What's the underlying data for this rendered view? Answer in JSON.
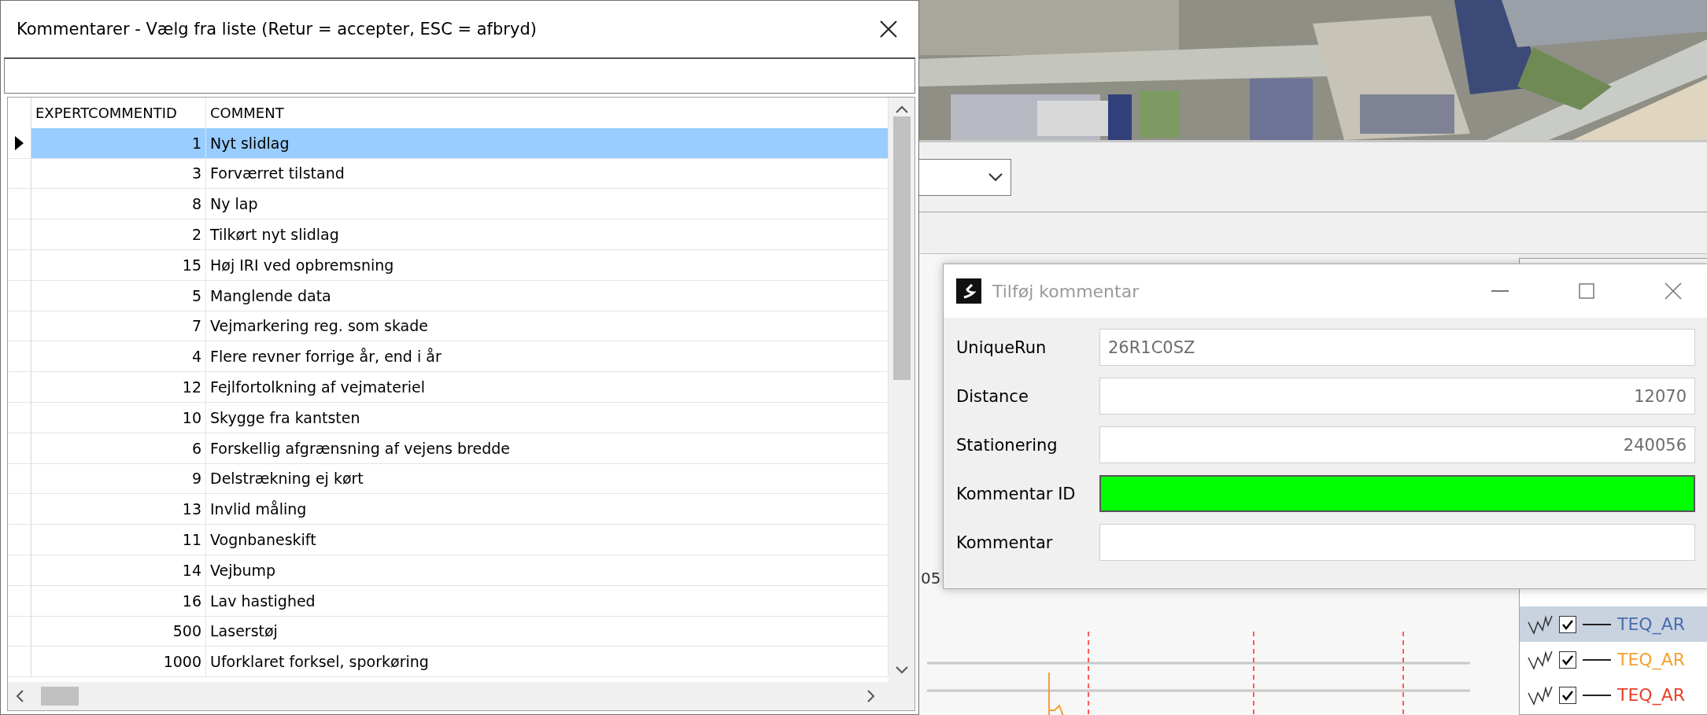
{
  "list_window": {
    "title": "Kommentarer - Vælg fra liste (Retur = accepter, ESC = afbryd)",
    "columns": [
      "EXPERTCOMMENTID",
      "COMMENT"
    ],
    "rows": [
      {
        "id": "1",
        "comment": "Nyt slidlag",
        "selected": true
      },
      {
        "id": "3",
        "comment": "Forværret tilstand",
        "selected": false
      },
      {
        "id": "8",
        "comment": "Ny lap",
        "selected": false
      },
      {
        "id": "2",
        "comment": "Tilkørt nyt slidlag",
        "selected": false
      },
      {
        "id": "15",
        "comment": "Høj IRI ved opbremsning",
        "selected": false
      },
      {
        "id": "5",
        "comment": "Manglende data",
        "selected": false
      },
      {
        "id": "7",
        "comment": "Vejmarkering reg. som skade",
        "selected": false
      },
      {
        "id": "4",
        "comment": "Flere revner forrige år, end i år",
        "selected": false
      },
      {
        "id": "12",
        "comment": "Fejlfortolkning af vejmateriel",
        "selected": false
      },
      {
        "id": "10",
        "comment": "Skygge fra kantsten",
        "selected": false
      },
      {
        "id": "6",
        "comment": "Forskellig afgrænsning af vejens bredde",
        "selected": false
      },
      {
        "id": "9",
        "comment": "Delstrækning ej kørt",
        "selected": false
      },
      {
        "id": "13",
        "comment": "Invlid måling",
        "selected": false
      },
      {
        "id": "11",
        "comment": "Vognbaneskift",
        "selected": false
      },
      {
        "id": "14",
        "comment": "Vejbump",
        "selected": false
      },
      {
        "id": "16",
        "comment": "Lav hastighed",
        "selected": false
      },
      {
        "id": "500",
        "comment": "Laserstøj",
        "selected": false
      },
      {
        "id": "1000",
        "comment": "Uforklaret forksel, sporkøring",
        "selected": false
      }
    ]
  },
  "background": {
    "axis_label": "05",
    "legend": [
      {
        "label": "TEQ_AR",
        "color": "#4a6db0",
        "checked": true,
        "selected": true
      },
      {
        "label": "TEQ_AR",
        "color": "#f5a030",
        "checked": true,
        "selected": false
      },
      {
        "label": "TEQ_AR",
        "color": "#e8412b",
        "checked": true,
        "selected": false
      }
    ]
  },
  "comment_dialog": {
    "title": "Tilføj kommentar",
    "fields": [
      {
        "label": "UniqueRun",
        "value": "26R1C0SZ",
        "kind": "text",
        "highlighted": false
      },
      {
        "label": "Distance",
        "value": "12070",
        "kind": "number",
        "highlighted": false
      },
      {
        "label": "Stationering",
        "value": "240056",
        "kind": "number",
        "highlighted": false
      },
      {
        "label": "Kommentar ID",
        "kind": "text",
        "highlighted": true
      },
      {
        "label": "Kommentar",
        "kind": "text",
        "highlighted": false
      }
    ]
  }
}
